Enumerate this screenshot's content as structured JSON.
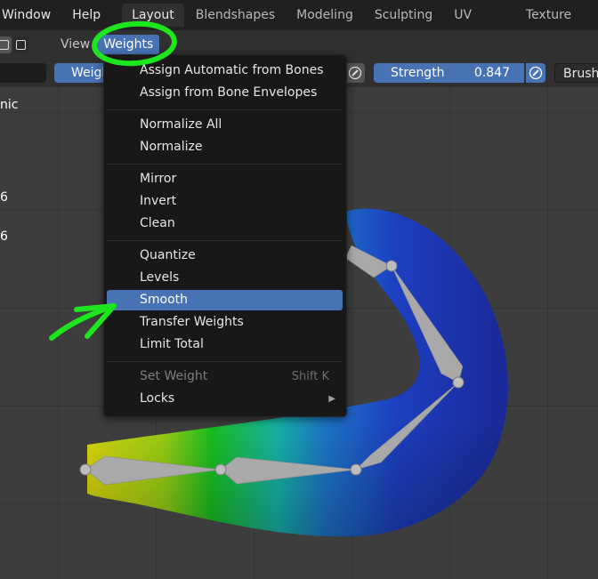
{
  "topbar": {
    "menus": [
      "Window",
      "Help"
    ],
    "tabs": [
      "Layout",
      "Blendshapes",
      "Modeling",
      "Sculpting",
      "UV Editing",
      "Texture Paint"
    ],
    "active_tab": "Layout"
  },
  "header": {
    "view_label": "View",
    "weights_label": "Weights"
  },
  "tool_settings": {
    "weight_label": "Weigh",
    "strength_label": "Strength",
    "strength_value": "0.847",
    "brush_label": "Brush"
  },
  "side_panel": {
    "line1": "nic",
    "line2": "6",
    "line3": "6"
  },
  "weights_menu": {
    "items": [
      {
        "label": "Assign Automatic from Bones"
      },
      {
        "label": "Assign from Bone Envelopes"
      },
      {
        "label": "Normalize All"
      },
      {
        "label": "Normalize"
      },
      {
        "label": "Mirror"
      },
      {
        "label": "Invert"
      },
      {
        "label": "Clean"
      },
      {
        "label": "Quantize"
      },
      {
        "label": "Levels"
      },
      {
        "label": "Smooth",
        "selected": true
      },
      {
        "label": "Transfer Weights"
      },
      {
        "label": "Limit Total"
      },
      {
        "label": "Set Weight",
        "shortcut": "Shift K",
        "disabled": true
      },
      {
        "label": "Locks",
        "submenu": true
      }
    ]
  },
  "colors": {
    "accent": "#4772b3",
    "annotation_green": "#1ee61e",
    "mesh_blue": "#1a2ab0",
    "mesh_green": "#18c020",
    "mesh_yellow": "#e0e010"
  }
}
